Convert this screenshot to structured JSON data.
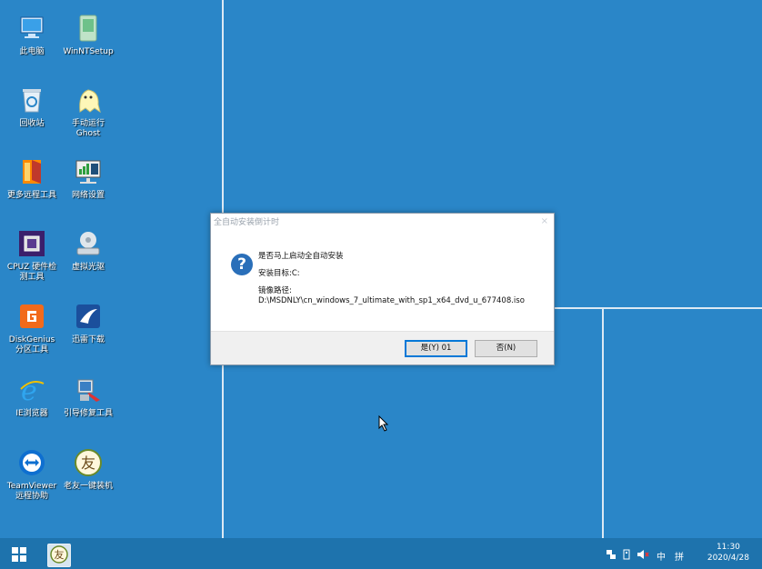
{
  "desktop": {
    "icons": [
      {
        "label": "此电脑",
        "icon": "computer-icon"
      },
      {
        "label": "WinNTSetup",
        "icon": "winntsetup-icon"
      },
      {
        "label": "回收站",
        "icon": "recycle-bin-icon"
      },
      {
        "label": "手动运行\nGhost",
        "icon": "ghost-icon"
      },
      {
        "label": "更多远程工具",
        "icon": "remote-tools-icon"
      },
      {
        "label": "网络设置",
        "icon": "network-settings-icon"
      },
      {
        "label": "CPUZ 硬件检\n测工具",
        "icon": "cpuz-icon"
      },
      {
        "label": "虚拟光驱",
        "icon": "virtual-drive-icon"
      },
      {
        "label": "DiskGenius\n分区工具",
        "icon": "diskgenius-icon"
      },
      {
        "label": "迅雷下载",
        "icon": "thunder-icon"
      },
      {
        "label": "IE浏览器",
        "icon": "ie-icon"
      },
      {
        "label": "引导修复工具",
        "icon": "boot-repair-icon"
      },
      {
        "label": "TeamViewer\n远程协助",
        "icon": "teamviewer-icon"
      },
      {
        "label": "老友一键装机",
        "icon": "laoyou-installer-icon"
      }
    ]
  },
  "dialog": {
    "title": "全自动安装倒计时",
    "close": "×",
    "question_icon": "?",
    "line1": "是否马上启动全自动安装",
    "line2": "安装目标:C:",
    "line3": "镜像路径:",
    "line4": "D:\\MSDNLY\\cn_windows_7_ultimate_with_sp1_x64_dvd_u_677408.iso",
    "yes_button": "是(Y) 01",
    "no_button": "否(N)"
  },
  "taskbar": {
    "ime_mode": "中",
    "ime_layout": "拼",
    "time": "11:30",
    "date": "2020/4/28"
  },
  "colors": {
    "desktop": "#2a86c8",
    "taskbar": "#1e73ad",
    "accent": "#0078d7"
  }
}
